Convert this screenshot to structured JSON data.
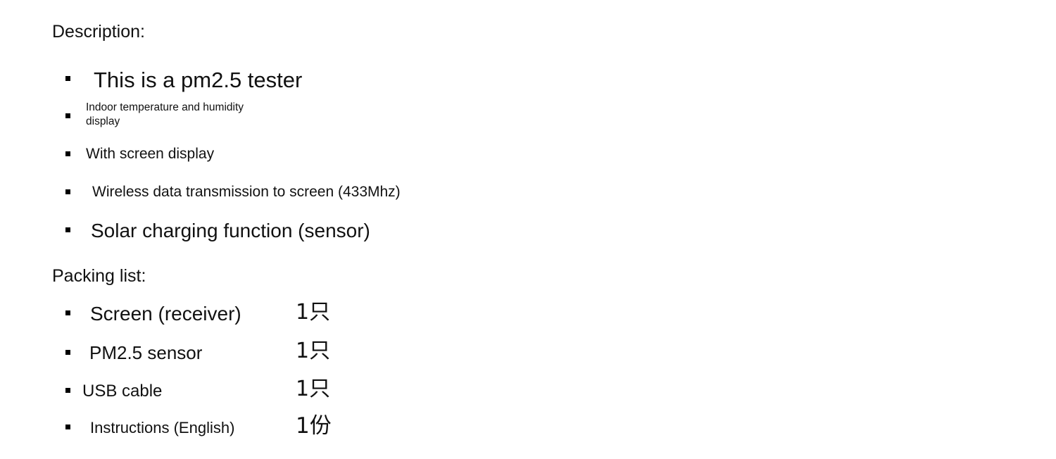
{
  "slide": {
    "background_color": "#ffffff",
    "text_color": "#111111",
    "bullet_color": "#000000"
  },
  "description": {
    "heading": "Description:",
    "items": [
      {
        "text": "This is a pm2.5 tester"
      },
      {
        "text": "Indoor temperature and humidity\ndisplay"
      },
      {
        "text": "With screen display"
      },
      {
        "text": "Wireless data transmission to screen (433Mhz)"
      },
      {
        "text": "Solar charging function (sensor)"
      }
    ]
  },
  "packing_list": {
    "heading": "Packing list:",
    "items": [
      {
        "name": "Screen (receiver)",
        "quantity": "1只"
      },
      {
        "name": "PM2.5 sensor",
        "quantity": "1只"
      },
      {
        "name": "USB cable",
        "quantity": "1只"
      },
      {
        "name": "Instructions (English)",
        "quantity": "1份"
      }
    ]
  }
}
